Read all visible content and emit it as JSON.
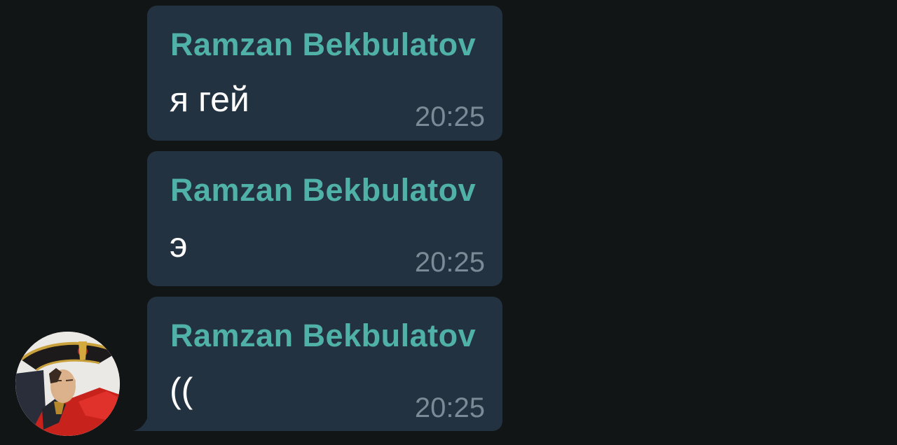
{
  "messages": [
    {
      "sender": "Ramzan Bekbulatov",
      "text": "я гей",
      "time": "20:25"
    },
    {
      "sender": "Ramzan Bekbulatov",
      "text": "э",
      "time": "20:25"
    },
    {
      "sender": "Ramzan Bekbulatov",
      "text": "((",
      "time": "20:25"
    }
  ],
  "colors": {
    "background": "#121516",
    "bubble": "#233240",
    "sender_name": "#4fb1a7",
    "message_text": "#ffffff",
    "timestamp": "#7b8a96"
  },
  "avatar": {
    "icon": "napoleon-portrait-avatar"
  }
}
